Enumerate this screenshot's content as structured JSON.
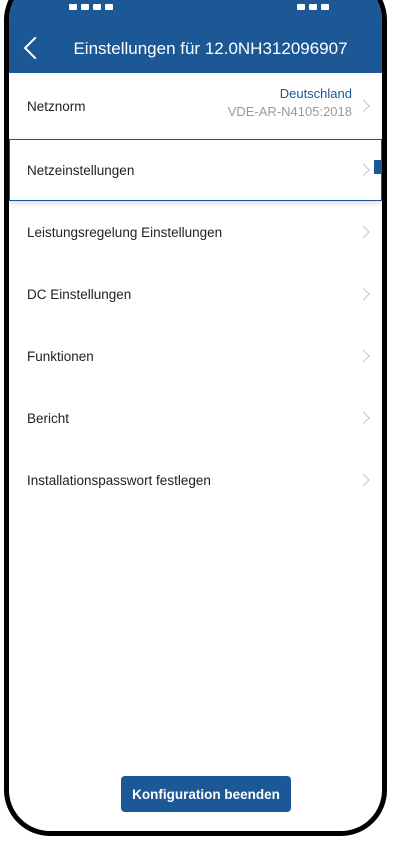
{
  "header": {
    "title": "Einstellungen für 12.0NH312096907"
  },
  "settings": {
    "netznorm": {
      "label": "Netznorm",
      "country": "Deutschland",
      "standard": "VDE-AR-N4105:2018"
    },
    "items": [
      {
        "label": "Netzeinstellungen"
      },
      {
        "label": "Leistungsregelung Einstellungen"
      },
      {
        "label": "DC Einstellungen"
      },
      {
        "label": "Funktionen"
      },
      {
        "label": "Bericht"
      },
      {
        "label": "Installationspasswort festlegen"
      }
    ]
  },
  "footer": {
    "finish_label": "Konfiguration beenden"
  },
  "colors": {
    "header_bg": "#1c5796",
    "accent": "#1c5796",
    "value_gray": "#9a9a9a"
  },
  "icons": {
    "back": "chevron-left-icon",
    "row_arrow": "chevron-right-icon"
  }
}
